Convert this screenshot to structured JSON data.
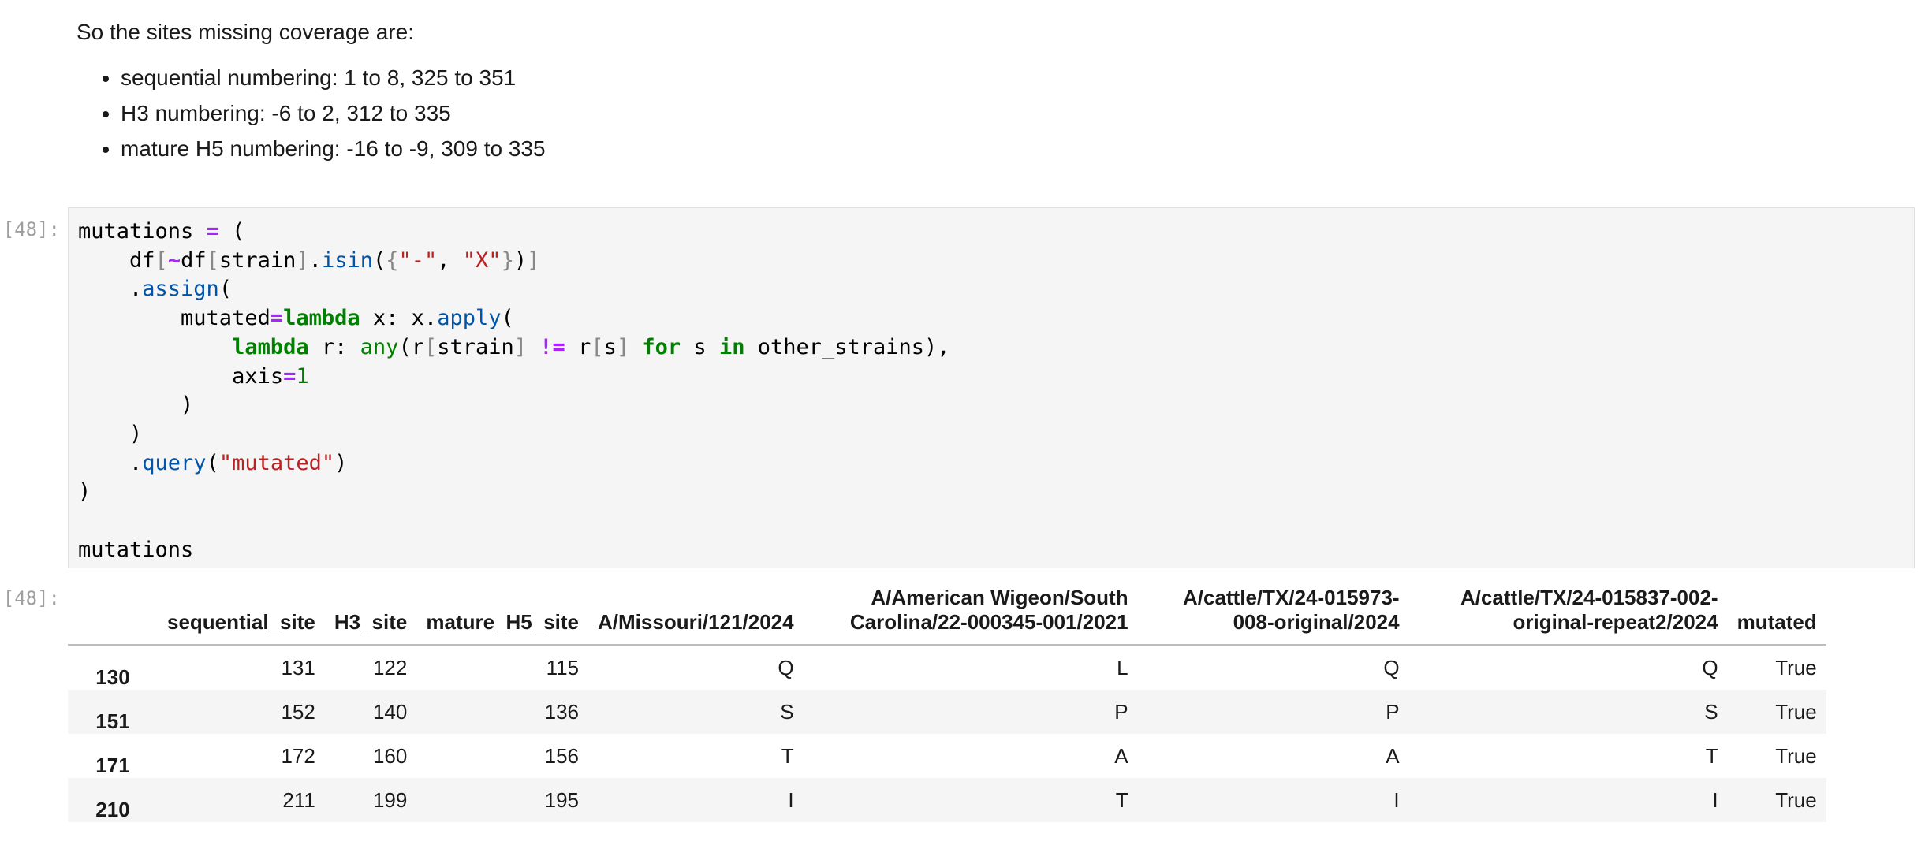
{
  "markdown": {
    "intro": "So the sites missing coverage are:",
    "bullets": [
      "sequential numbering: 1 to 8, 325 to 351",
      "H3 numbering: -6 to 2, 312 to 335",
      "mature H5 numbering: -16 to -9, 309 to 335"
    ]
  },
  "code_cell": {
    "prompt": "[48]:",
    "lines": [
      "mutations = (",
      "    df[~df[strain].isin({\"-\", \"X\"})]",
      "    .assign(",
      "        mutated=lambda x: x.apply(",
      "            lambda r: any(r[strain] != r[s] for s in other_strains),",
      "            axis=1",
      "        )",
      "    )",
      "    .query(\"mutated\")",
      ")",
      "",
      "mutations"
    ]
  },
  "output": {
    "prompt": "[48]:",
    "columns": [
      "",
      "sequential_site",
      "H3_site",
      "mature_H5_site",
      "A/Missouri/121/2024",
      "A/American Wigeon/South Carolina/22-000345-001/2021",
      "A/cattle/TX/24-015973-008-original/2024",
      "A/cattle/TX/24-015837-002-original-repeat2/2024",
      "mutated"
    ],
    "rows": [
      [
        "130",
        "131",
        "122",
        "115",
        "Q",
        "L",
        "Q",
        "Q",
        "True"
      ],
      [
        "151",
        "152",
        "140",
        "136",
        "S",
        "P",
        "P",
        "S",
        "True"
      ],
      [
        "171",
        "172",
        "160",
        "156",
        "T",
        "A",
        "A",
        "T",
        "True"
      ],
      [
        "210",
        "211",
        "199",
        "195",
        "I",
        "T",
        "I",
        "I",
        "True"
      ]
    ]
  }
}
